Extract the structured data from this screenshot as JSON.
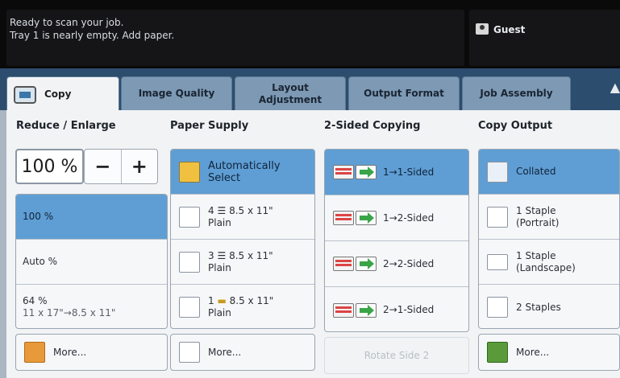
{
  "status": {
    "line1": "Ready to scan your job.",
    "line2": "Tray 1 is nearly empty. Add paper.",
    "user": "Guest"
  },
  "tabs": [
    {
      "label": "Copy"
    },
    {
      "label": "Image Quality"
    },
    {
      "label": "Layout\nAdjustment"
    },
    {
      "label": "Output Format"
    },
    {
      "label": "Job Assembly"
    }
  ],
  "reduce": {
    "title": "Reduce / Enlarge",
    "value": "100 %",
    "minus": "−",
    "plus": "+",
    "options": [
      {
        "label": "100 %"
      },
      {
        "label": "Auto %"
      },
      {
        "label": "64 %",
        "sub": "11 x 17\"→8.5 x 11\""
      }
    ],
    "more": "More..."
  },
  "paper": {
    "title": "Paper Supply",
    "options": [
      {
        "line1": "Automatically",
        "line2": "Select"
      },
      {
        "tray": "4",
        "size": "8.5 x 11\"",
        "type": "Plain"
      },
      {
        "tray": "3",
        "size": "8.5 x 11\"",
        "type": "Plain"
      },
      {
        "tray": "1",
        "size": "8.5 x 11\"",
        "type": "Plain"
      }
    ],
    "more": "More..."
  },
  "sided": {
    "title": "2-Sided Copying",
    "options": [
      {
        "label": "1→1-Sided"
      },
      {
        "label": "1→2-Sided"
      },
      {
        "label": "2→2-Sided"
      },
      {
        "label": "2→1-Sided"
      }
    ],
    "rotate": "Rotate Side 2"
  },
  "output": {
    "title": "Copy Output",
    "options": [
      {
        "label": "Collated"
      },
      {
        "line1": "1 Staple",
        "line2": "(Portrait)"
      },
      {
        "line1": "1 Staple",
        "line2": "(Landscape)"
      },
      {
        "label": "2 Staples"
      }
    ],
    "more": "More..."
  }
}
